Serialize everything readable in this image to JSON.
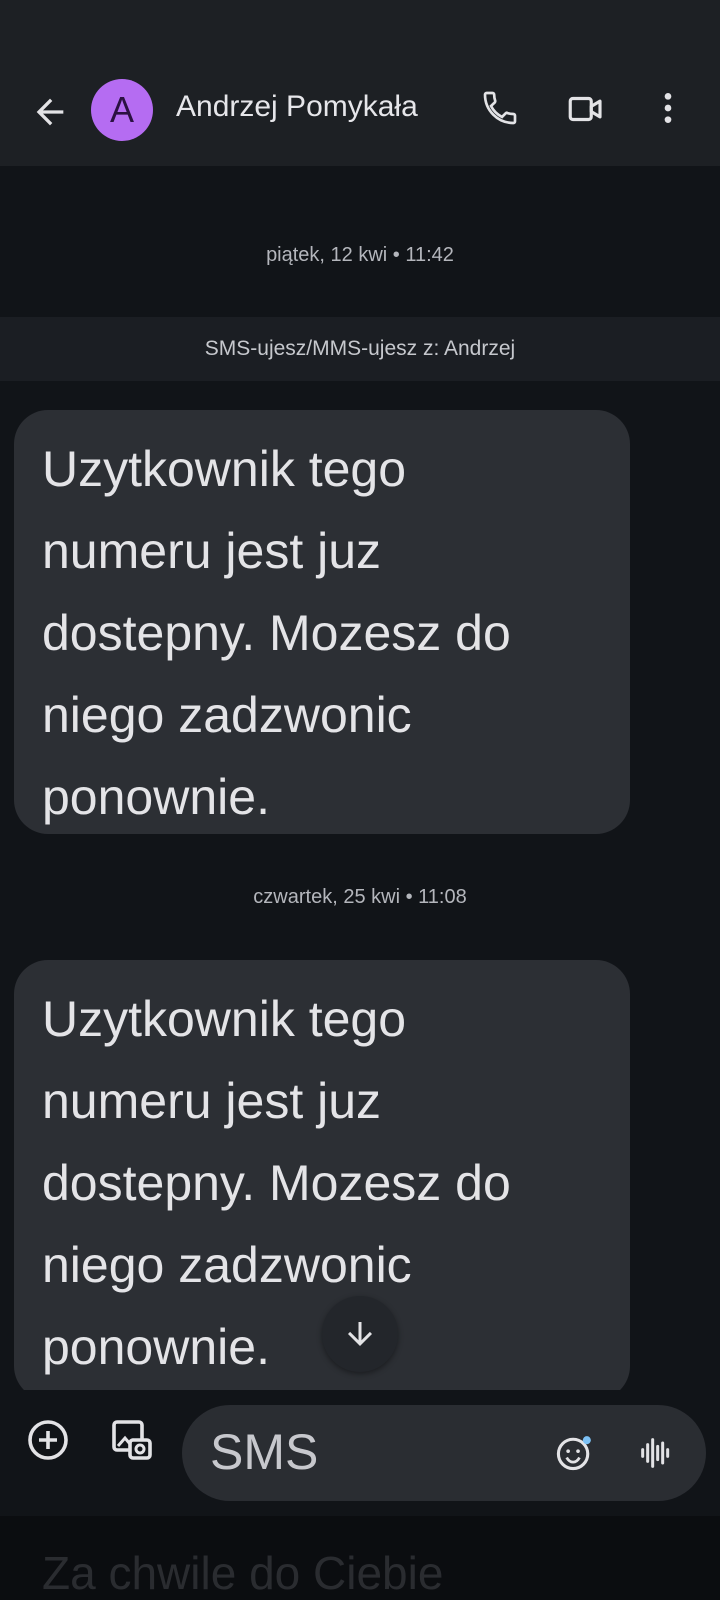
{
  "header": {
    "avatar_letter": "A",
    "contact_name": "Andrzej Pomykała",
    "icons": [
      "back-arrow-icon",
      "phone-icon",
      "video-icon",
      "more-vert-icon"
    ],
    "avatar_color": "#b56cf2"
  },
  "thread": {
    "date1": "piątek, 12 kwi • 11:42",
    "banner": "SMS-ujesz/MMS-ujesz z: Andrzej",
    "message1": "Uzytkownik tego\nnumeru jest juz\ndostepny. Mozesz do\nniego zadzwonic\nponownie.",
    "date2": "czwartek, 25 kwi • 11:08",
    "message2": "Uzytkownik tego\nnumeru jest juz\ndostepny. Mozesz do\nniego zadzwonic\nponownie."
  },
  "composer": {
    "placeholder": "SMS",
    "icons": [
      "add-circle-icon",
      "gallery-icon",
      "emoji-icon",
      "voice-icon"
    ]
  },
  "bottom_hint": "Za chwile do Ciebie"
}
